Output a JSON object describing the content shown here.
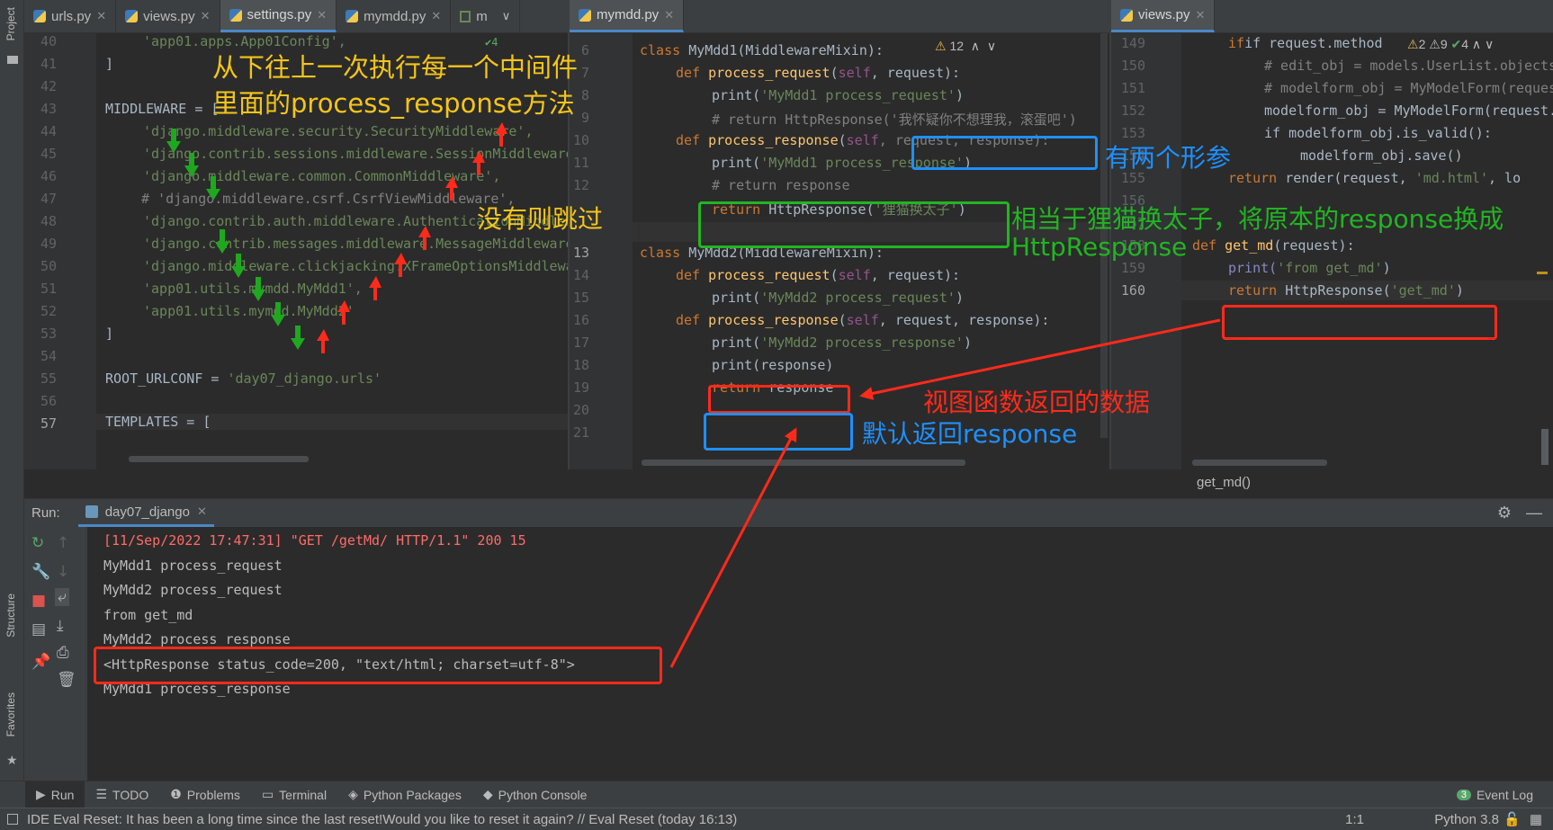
{
  "left_strip": {
    "project": "Project",
    "structure": "Structure",
    "favorites": "Favorites"
  },
  "tabs_left": [
    {
      "label": "urls.py"
    },
    {
      "label": "views.py"
    },
    {
      "label": "settings.py",
      "active": true
    },
    {
      "label": "mymdd.py"
    },
    {
      "label": "m"
    }
  ],
  "tab_mid": {
    "label": "mymdd.py"
  },
  "tab_right": {
    "label": "views.py"
  },
  "pane1": {
    "line_numbers": [
      "40",
      "41",
      "42",
      "43",
      "44",
      "45",
      "46",
      "47",
      "48",
      "49",
      "50",
      "51",
      "52",
      "53",
      "54",
      "55",
      "56",
      "57"
    ],
    "lines": {
      "l40": "'app01.apps.App01Config',",
      "l41": "]",
      "l43": "MIDDLEWARE = [",
      "l44": "'django.middleware.security.SecurityMiddleware',",
      "l45": "'django.contrib.sessions.middleware.SessionMiddleware',",
      "l46": "'django.middleware.common.CommonMiddleware',",
      "l47": "# 'django.middleware.csrf.CsrfViewMiddleware',",
      "l48": "'django.contrib.auth.middleware.AuthenticationMiddleware',",
      "l49": "'django.contrib.messages.middleware.MessageMiddleware',",
      "l50": "'django.middleware.clickjacking.XFrameOptionsMiddleware',",
      "l51": "'app01.utils.mymdd.MyMdd1',",
      "l52": "'app01.utils.mymdd.MyMdd2'",
      "l53": "]",
      "l55a": "ROOT_URLCONF = ",
      "l55b": "'day07_django.urls'",
      "l57": "TEMPLATES = ["
    },
    "inspection": "4"
  },
  "pane2": {
    "line_numbers": [
      "6",
      "7",
      "8",
      "9",
      "10",
      "11",
      "12",
      "13",
      "14",
      "15",
      "16",
      "17",
      "18",
      "19",
      "20",
      "21"
    ],
    "inspection": "12",
    "lines": {
      "c1a": "class ",
      "c1b": "MyMdd1(MiddlewareMixin):",
      "def": "def ",
      "pr": "process_request",
      "prs": "process_response",
      "self": "self",
      "req": ", request):",
      "reqresp": ", request, response):",
      "print": "print(",
      "s_req1": "'MyMdd1 process_request'",
      "cmt8": "# return HttpResponse('我怀疑你不想理我，滚蛋吧')",
      "s_resp1": "'MyMdd1 process_response'",
      "cmt11": "# return response",
      "ret": "return ",
      "httpr": "HttpResponse(",
      "s_swap": "'狸猫换太子'",
      "close": ")",
      "c2b": "MyMdd2(MiddlewareMixin):",
      "s_req2": "'MyMdd2 process_request'",
      "s_resp2": "'MyMdd2 process_response'",
      "printresp": "response)",
      "retresp": "response"
    }
  },
  "pane3": {
    "line_numbers": [
      "149",
      "150",
      "151",
      "152",
      "153",
      "154",
      "155",
      "156",
      "157",
      "158",
      "159",
      "160"
    ],
    "inspection": {
      "warn": "2",
      "weak": "9",
      "ok": "4"
    },
    "lines": {
      "l149": "if request.method ",
      "l150": "# edit_obj = models.UserList.objects",
      "l151": "# modelform_obj = MyModelForm(reques",
      "l152": "modelform_obj = MyModelForm(request.",
      "l153": "if modelform_obj.is_valid():",
      "l154": "modelform_obj.save()",
      "l155a": "return ",
      "l155b": "render(request, ",
      "l155c": "'md.html'",
      "l155d": ", lo",
      "l158a": "def ",
      "l158b": "get_md",
      "l158c": "(request):",
      "l159a": "print(",
      "l159b": "'from get_md'",
      "l159c": ")",
      "l160a": "return ",
      "l160b": "HttpResponse(",
      "l160c": "'get_md'",
      "l160d": ")"
    }
  },
  "breadcrumb": "get_md()",
  "run": {
    "label": "Run:",
    "config": "day07_django",
    "output": [
      "[11/Sep/2022 17:47:31] \"GET /getMd/ HTTP/1.1\" 200 15",
      "MyMdd1 process_request",
      "MyMdd2 process_request",
      "from get_md",
      "MyMdd2 process_response",
      "<HttpResponse status_code=200, \"text/html; charset=utf-8\">",
      "MyMdd1 process_response"
    ]
  },
  "bottom_tabs": [
    "Run",
    "TODO",
    "Problems",
    "Terminal",
    "Python Packages",
    "Python Console"
  ],
  "event_log": {
    "count": "3",
    "label": "Event Log"
  },
  "status": {
    "message": "IDE Eval Reset: It has been a long time since the last reset!Would you like to reset it again? // Eval Reset (today 16:13)",
    "position": "1:1",
    "interpreter": "Python 3.8"
  },
  "annotations": {
    "order_note_1": "从下往上一次执行每一个中间件",
    "order_note_2": "里面的process_response方法",
    "skip_note": "没有则跳过",
    "two_params": "有两个形参",
    "swap_note_1": "相当于狸猫换太子，将原本的response换成",
    "swap_note_2": "HttpResponse",
    "view_data": "视图函数返回的数据",
    "default_return": "默认返回response"
  },
  "colors": {
    "annot_yellow": "#f5c518",
    "annot_blue": "#1e90ff",
    "annot_green": "#22b522",
    "annot_red": "#ff2a1a"
  }
}
